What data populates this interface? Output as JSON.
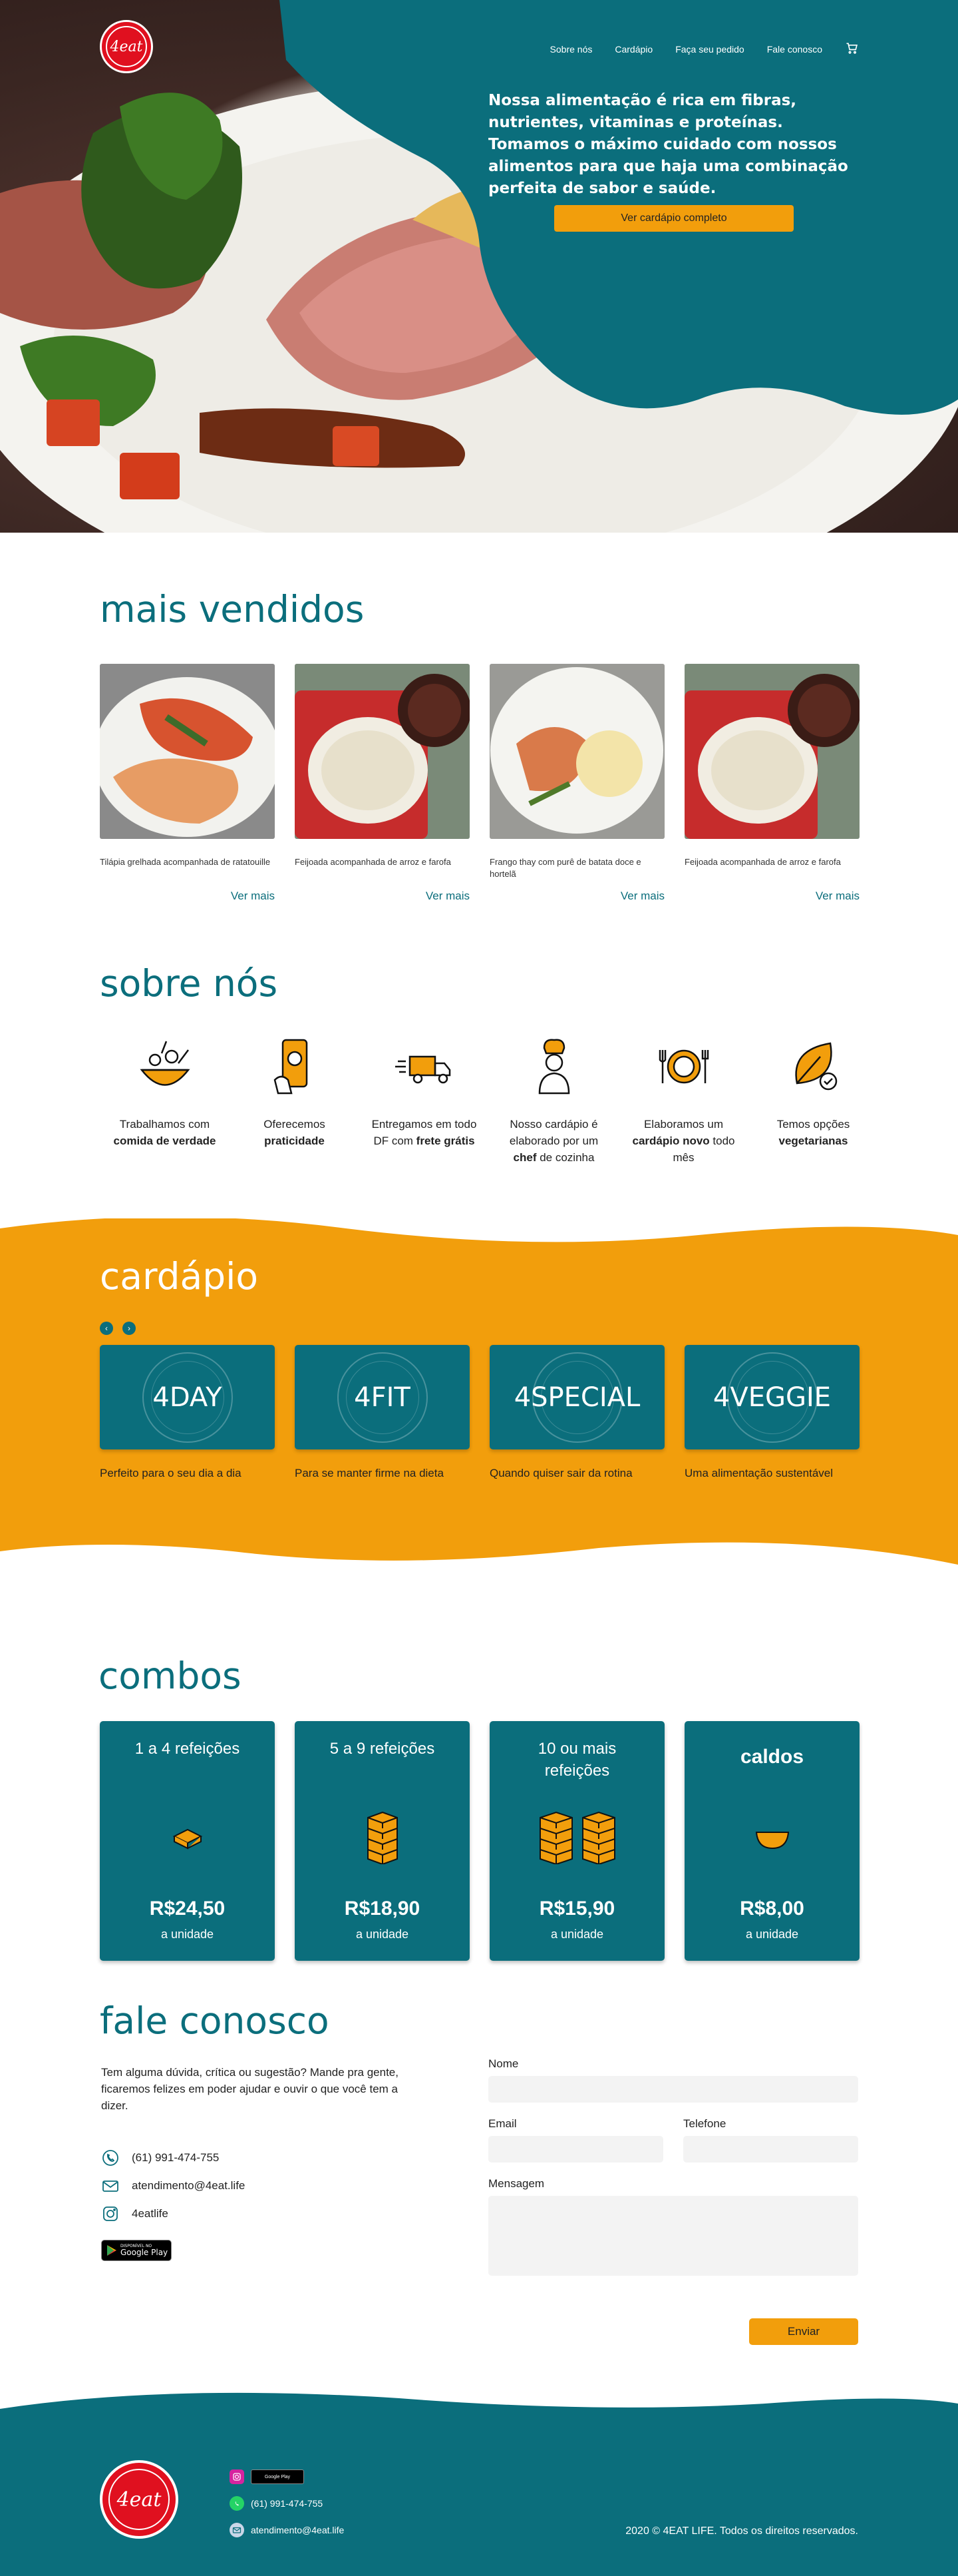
{
  "nav": {
    "logo_text": "4eat",
    "items": [
      "Sobre nós",
      "Cardápio",
      "Faça seu pedido",
      "Fale conosco"
    ]
  },
  "hero": {
    "text": "Nossa alimentação é rica em fibras, nutrientes, vitaminas e proteínas. Tomamos o máximo cuidado com nossos alimentos para que haja uma combinação perfeita de sabor e saúde.",
    "button": "Ver cardápio completo"
  },
  "mais_vendidos": {
    "title": "mais vendidos",
    "items": [
      {
        "desc": "Tilápia grelhada acompanhada de ratatouille",
        "link": "Ver mais"
      },
      {
        "desc": "Feijoada acompanhada de arroz e farofa",
        "link": "Ver mais"
      },
      {
        "desc": "Frango thay com purê de batata doce e hortelã",
        "link": "Ver mais"
      },
      {
        "desc": "Feijoada acompanhada de arroz e farofa",
        "link": "Ver mais"
      }
    ]
  },
  "sobre_nos": {
    "title": "sobre nós",
    "items": [
      {
        "pre": "Trabalhamos com ",
        "bold": "comida de verdade",
        "post": ""
      },
      {
        "pre": "Oferecemos ",
        "bold": "praticidade",
        "post": ""
      },
      {
        "pre": "Entregamos em todo DF com ",
        "bold": "frete grátis",
        "post": ""
      },
      {
        "pre": "Nosso cardápio é elaborado por um ",
        "bold": "chef",
        "post": " de cozinha"
      },
      {
        "pre": "Elaboramos um ",
        "bold": "cardápio novo",
        "post": " todo mês"
      },
      {
        "pre": "Temos opções ",
        "bold": "vegetarianas",
        "post": ""
      }
    ]
  },
  "cardapio": {
    "title": "cardápio",
    "items": [
      {
        "name": "4DAY",
        "desc": "Perfeito para o seu dia a dia"
      },
      {
        "name": "4FIT",
        "desc": "Para se manter firme na dieta"
      },
      {
        "name": "4SPECIAL",
        "desc": "Quando quiser sair da rotina"
      },
      {
        "name": "4VEGGIE",
        "desc": "Uma alimentação sustentável"
      }
    ]
  },
  "combos": {
    "title": "combos",
    "items": [
      {
        "title": "1 a 4 refeições",
        "price": "R$24,50",
        "unit": "a unidade"
      },
      {
        "title": "5 a 9 refeições",
        "price": "R$18,90",
        "unit": "a unidade"
      },
      {
        "title": "10 ou mais refeições",
        "price": "R$15,90",
        "unit": "a unidade"
      },
      {
        "title": "caldos",
        "price": "R$8,00",
        "unit": "a unidade"
      }
    ]
  },
  "fale_conosco": {
    "title": "fale conosco",
    "intro": "Tem alguma dúvida, crítica ou sugestão? Mande pra gente, ficaremos felizes em poder ajudar e ouvir o que você tem a dizer.",
    "phone": "(61) 991-474-755",
    "email": "atendimento@4eat.life",
    "instagram": "4eatlife",
    "gp_small": "DISPONÍVEL NO",
    "gp_large": "Google Play",
    "form": {
      "name_label": "Nome",
      "email_label": "Email",
      "phone_label": "Telefone",
      "message_label": "Mensagem",
      "send": "Enviar"
    }
  },
  "footer": {
    "phone": "(61) 991-474-755",
    "email": "atendimento@4eat.life",
    "gp": "Google Play",
    "copyright": "2020 © 4EAT LIFE. Todos os direitos reservados."
  },
  "colors": {
    "teal": "#0b6e7c",
    "orange": "#f29e0c",
    "logo_red": "#e0101f"
  }
}
